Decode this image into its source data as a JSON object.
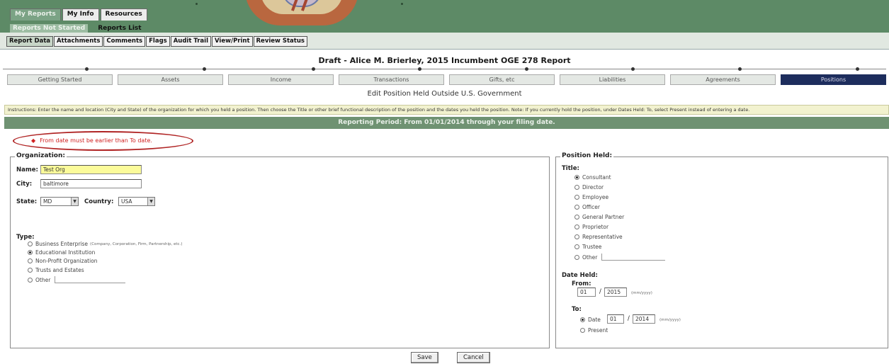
{
  "header": {
    "top_tabs": [
      {
        "label": "My Reports",
        "active": true
      },
      {
        "label": "My Info",
        "active": false
      },
      {
        "label": "Resources",
        "active": false
      }
    ],
    "subnav": [
      {
        "label": "Reports Not Started",
        "active": true
      },
      {
        "label": "Reports List",
        "active": false
      }
    ]
  },
  "section_tabs": [
    {
      "label": "Report Data",
      "active": true
    },
    {
      "label": "Attachments",
      "active": false
    },
    {
      "label": "Comments",
      "active": false
    },
    {
      "label": "Flags",
      "active": false
    },
    {
      "label": "Audit Trail",
      "active": false
    },
    {
      "label": "View/Print",
      "active": false
    },
    {
      "label": "Review Status",
      "active": false
    }
  ],
  "report_title": "Draft - Alice M. Brierley, 2015 Incumbent OGE 278 Report",
  "steps": [
    {
      "label": "Getting Started",
      "active": false
    },
    {
      "label": "Assets",
      "active": false
    },
    {
      "label": "Income",
      "active": false
    },
    {
      "label": "Transactions",
      "active": false
    },
    {
      "label": "Gifts, etc",
      "active": false
    },
    {
      "label": "Liabilities",
      "active": false
    },
    {
      "label": "Agreements",
      "active": false
    },
    {
      "label": "Positions",
      "active": true
    }
  ],
  "page_title": "Edit Position Held Outside U.S. Government",
  "instructions": "Instructions: Enter the name and location (City and State) of the organization for which you held a position. Then choose the Title or other brief functional description of the position and the dates you held the position. Note: If you currently hold the position, under Dates Held: To, select Present instead of entering a date.",
  "reporting_period": "Reporting Period: From 01/01/2014 through your filing date.",
  "error": {
    "message": "From date must be earlier than To date."
  },
  "organization": {
    "legend": "Organization:",
    "name_label": "Name:",
    "name_value": "Test Org",
    "city_label": "City:",
    "city_value": "baltimore",
    "state_label": "State:",
    "state_value": "MD",
    "country_label": "Country:",
    "country_value": "USA",
    "type_label": "Type:",
    "types": [
      {
        "label": "Business Enterprise",
        "note": "(Company, Corporation, Firm, Partnership, etc.)",
        "selected": false
      },
      {
        "label": "Educational Institution",
        "note": "",
        "selected": true
      },
      {
        "label": "Non-Profit Organization",
        "note": "",
        "selected": false
      },
      {
        "label": "Trusts and Estates",
        "note": "",
        "selected": false
      },
      {
        "label": "Other",
        "note": "",
        "selected": false
      }
    ]
  },
  "position": {
    "legend": "Position Held:",
    "title_label": "Title:",
    "titles": [
      {
        "label": "Consultant",
        "selected": true
      },
      {
        "label": "Director",
        "selected": false
      },
      {
        "label": "Employee",
        "selected": false
      },
      {
        "label": "Officer",
        "selected": false
      },
      {
        "label": "General Partner",
        "selected": false
      },
      {
        "label": "Proprietor",
        "selected": false
      },
      {
        "label": "Representative",
        "selected": false
      },
      {
        "label": "Trustee",
        "selected": false
      },
      {
        "label": "Other",
        "selected": false
      }
    ],
    "date_held_label": "Date Held:",
    "from_label": "From:",
    "from_month": "01",
    "from_year": "2015",
    "date_format_hint": "(mm/yyyy)",
    "to_label": "To:",
    "to_options": [
      {
        "label": "Date",
        "selected": true
      },
      {
        "label": "Present",
        "selected": false
      }
    ],
    "to_month": "01",
    "to_year": "2014"
  },
  "buttons": {
    "save": "Save",
    "cancel": "Cancel"
  }
}
